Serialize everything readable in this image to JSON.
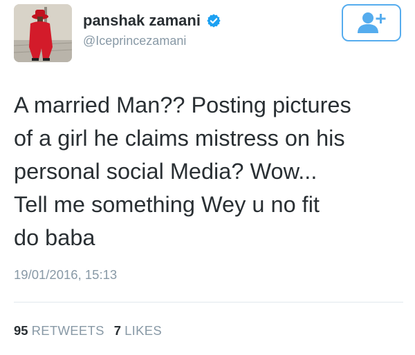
{
  "profile": {
    "display_name": "panshak zamani",
    "handle": "@Iceprincezamani",
    "verified": true,
    "avatar_icon": "profile-photo-man-in-red-suit"
  },
  "follow_button": {
    "icon": "user-plus-icon"
  },
  "tweet": {
    "text": "A married Man?? Posting pictures\nof a girl he claims mistress on his\npersonal social Media? Wow...\nTell me something Wey u no fit\ndo baba",
    "timestamp": "19/01/2016, 15:13"
  },
  "stats": {
    "retweets_count": "95",
    "retweets_label": "RETWEETS",
    "likes_count": "7",
    "likes_label": "LIKES"
  },
  "colors": {
    "accent": "#55acee",
    "verified": "#1da1f2",
    "text": "#292f33",
    "muted": "#8899a6"
  }
}
